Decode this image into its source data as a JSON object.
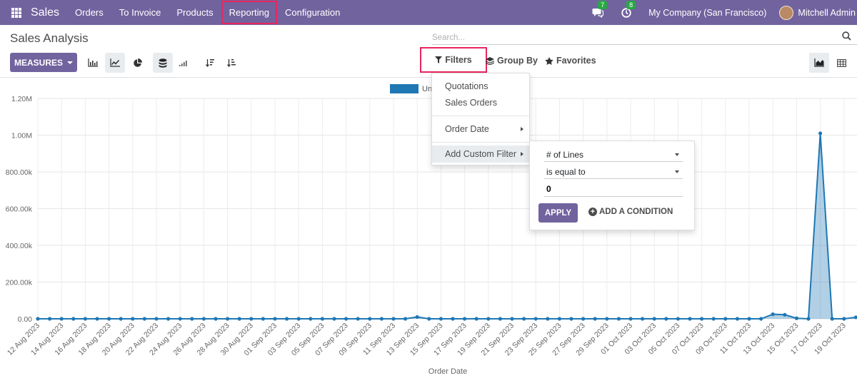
{
  "navbar": {
    "brand": "Sales",
    "menu": [
      "Orders",
      "To Invoice",
      "Products",
      "Reporting",
      "Configuration"
    ],
    "active_menu": "Reporting",
    "messages_count": "7",
    "activities_count": "8",
    "company": "My Company (San Francisco)",
    "user": "Mitchell Admin"
  },
  "page": {
    "title": "Sales Analysis",
    "search_placeholder": "Search..."
  },
  "toolbar": {
    "measures_label": "MEASURES",
    "filters_label": "Filters",
    "group_by_label": "Group By",
    "favorites_label": "Favorites"
  },
  "filter_menu": {
    "items": [
      "Quotations",
      "Sales Orders",
      "Order Date",
      "Add Custom Filter"
    ]
  },
  "custom_filter": {
    "field": "# of Lines",
    "operator": "is equal to",
    "value": "0",
    "apply_label": "APPLY",
    "add_condition_label": "ADD A CONDITION"
  },
  "chart_data": {
    "type": "area",
    "legend_label": "Un",
    "legend_color": "#1f77b4",
    "xlabel": "Order Date",
    "y_ticks": [
      "0.00",
      "200.00k",
      "400.00k",
      "600.00k",
      "800.00k",
      "1.00M",
      "1.20M"
    ],
    "ylim": [
      0,
      1200000
    ],
    "x_tick_labels": [
      "12 Aug 2023",
      "14 Aug 2023",
      "16 Aug 2023",
      "18 Aug 2023",
      "20 Aug 2023",
      "22 Aug 2023",
      "24 Aug 2023",
      "26 Aug 2023",
      "28 Aug 2023",
      "30 Aug 2023",
      "01 Sep 2023",
      "03 Sep 2023",
      "05 Sep 2023",
      "07 Sep 2023",
      "09 Sep 2023",
      "11 Sep 2023",
      "13 Sep 2023",
      "15 Sep 2023",
      "17 Sep 2023",
      "19 Sep 2023",
      "21 Sep 2023",
      "23 Sep 2023",
      "25 Sep 2023",
      "27 Sep 2023",
      "29 Sep 2023",
      "01 Oct 2023",
      "03 Oct 2023",
      "05 Oct 2023",
      "07 Oct 2023",
      "09 Oct 2023",
      "11 Oct 2023",
      "13 Oct 2023",
      "15 Oct 2023",
      "17 Oct 2023",
      "19 Oct 2023"
    ],
    "x": [
      "12 Aug 2023",
      "13 Aug 2023",
      "14 Aug 2023",
      "15 Aug 2023",
      "16 Aug 2023",
      "17 Aug 2023",
      "18 Aug 2023",
      "19 Aug 2023",
      "20 Aug 2023",
      "21 Aug 2023",
      "22 Aug 2023",
      "23 Aug 2023",
      "24 Aug 2023",
      "25 Aug 2023",
      "26 Aug 2023",
      "27 Aug 2023",
      "28 Aug 2023",
      "29 Aug 2023",
      "30 Aug 2023",
      "31 Aug 2023",
      "01 Sep 2023",
      "02 Sep 2023",
      "03 Sep 2023",
      "04 Sep 2023",
      "05 Sep 2023",
      "06 Sep 2023",
      "07 Sep 2023",
      "08 Sep 2023",
      "09 Sep 2023",
      "10 Sep 2023",
      "11 Sep 2023",
      "12 Sep 2023",
      "13 Sep 2023",
      "14 Sep 2023",
      "15 Sep 2023",
      "16 Sep 2023",
      "17 Sep 2023",
      "18 Sep 2023",
      "19 Sep 2023",
      "20 Sep 2023",
      "21 Sep 2023",
      "22 Sep 2023",
      "23 Sep 2023",
      "24 Sep 2023",
      "25 Sep 2023",
      "26 Sep 2023",
      "27 Sep 2023",
      "28 Sep 2023",
      "29 Sep 2023",
      "30 Sep 2023",
      "01 Oct 2023",
      "02 Oct 2023",
      "03 Oct 2023",
      "04 Oct 2023",
      "05 Oct 2023",
      "06 Oct 2023",
      "07 Oct 2023",
      "08 Oct 2023",
      "09 Oct 2023",
      "10 Oct 2023",
      "11 Oct 2023",
      "12 Oct 2023",
      "13 Oct 2023",
      "14 Oct 2023",
      "15 Oct 2023",
      "16 Oct 2023",
      "17 Oct 2023",
      "18 Oct 2023",
      "19 Oct 2023",
      "20 Oct 2023",
      "21 Oct 2023"
    ],
    "values": [
      0,
      0,
      0,
      0,
      0,
      0,
      0,
      0,
      0,
      0,
      0,
      0,
      0,
      0,
      0,
      0,
      0,
      0,
      0,
      0,
      0,
      0,
      0,
      0,
      0,
      0,
      0,
      0,
      0,
      0,
      0,
      0,
      10000,
      0,
      0,
      0,
      0,
      0,
      0,
      0,
      0,
      0,
      0,
      0,
      0,
      0,
      0,
      0,
      0,
      0,
      0,
      0,
      0,
      0,
      0,
      0,
      0,
      0,
      0,
      0,
      0,
      0,
      25000,
      22000,
      3000,
      0,
      1010000,
      0,
      0,
      8000,
      30000
    ],
    "grid": true
  }
}
